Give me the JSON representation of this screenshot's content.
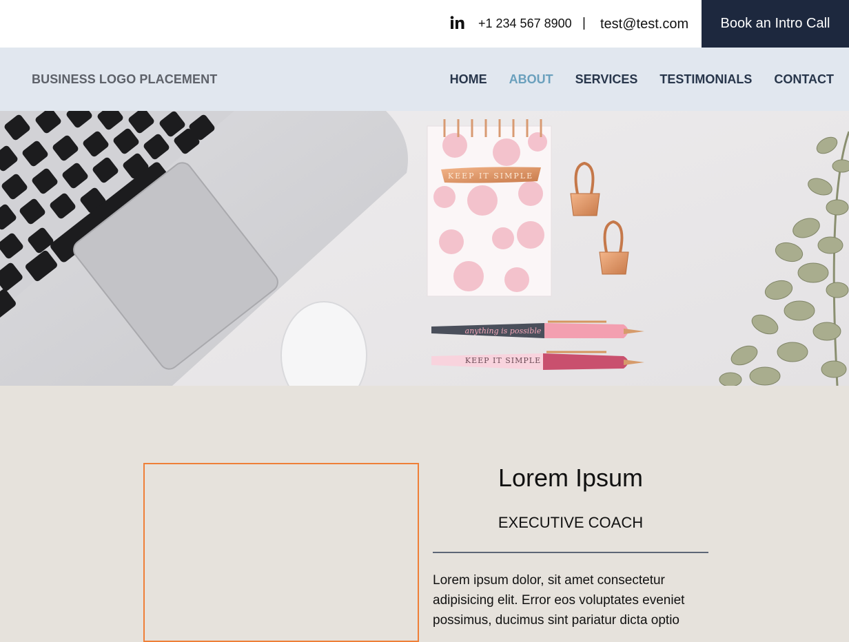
{
  "topbar": {
    "linkedin_icon": "linkedin-icon",
    "phone": "+1 234 567 8900",
    "separator": "|",
    "email": "test@test.com",
    "cta_label": "Book an Intro Call",
    "cta_color": "#1d283e"
  },
  "navbar": {
    "logo_text": "BUSINESS LOGO PLACEMENT",
    "items": [
      {
        "label": "HOME",
        "active": false
      },
      {
        "label": "ABOUT",
        "active": true
      },
      {
        "label": "SERVICES",
        "active": false
      },
      {
        "label": "TESTIMONIALS",
        "active": false
      },
      {
        "label": "CONTACT",
        "active": false
      }
    ],
    "active_color": "#6aa0bd"
  },
  "hero": {
    "notebook_text": "KEEP IT SIMPLE",
    "pen1_text": "anything is possible",
    "pen2_text": "KEEP IT SIMPLE"
  },
  "about": {
    "name": "Lorem Ipsum",
    "role": "EXECUTIVE COACH",
    "bio": "Lorem ipsum dolor, sit amet consectetur adipisicing elit. Error eos voluptates eveniet possimus, ducimus sint pariatur dicta optio",
    "frame_color": "#ef7f37"
  }
}
